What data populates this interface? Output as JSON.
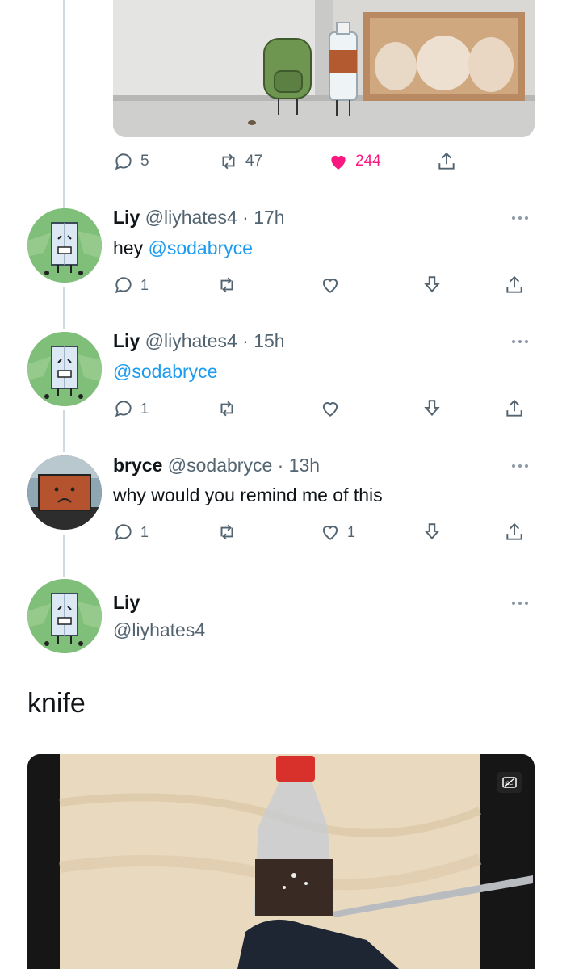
{
  "main_tweet": {
    "actions": {
      "reply_count": "5",
      "retweet_count": "47",
      "like_count": "244"
    }
  },
  "replies": [
    {
      "name": "Liy",
      "handle": "@liyhates4",
      "time": "· 17h",
      "text_prefix": "hey ",
      "mention": "@sodabryce",
      "reply_count": "1",
      "like_count": ""
    },
    {
      "name": "Liy",
      "handle": "@liyhates4",
      "time": "· 15h",
      "text_prefix": "",
      "mention": "@sodabryce",
      "reply_count": "1",
      "like_count": ""
    },
    {
      "name": "bryce",
      "handle": "@sodabryce",
      "time": "· 13h",
      "text_prefix": "why would you remind me of this",
      "mention": "",
      "reply_count": "1",
      "like_count": "1"
    }
  ],
  "focused_tweet": {
    "name": "Liy",
    "handle": "@liyhates4",
    "text": "knife"
  },
  "icons": {
    "reply": "reply-icon",
    "retweet": "retweet-icon",
    "like": "heart-icon",
    "bookmark": "bookmark-icon",
    "share": "share-icon",
    "more": "more-icon",
    "captions": "captions-icon"
  },
  "colors": {
    "like_active": "#f91880",
    "link": "#1d9bf0",
    "secondary_text": "#536471",
    "thread_line": "#cfd9de"
  }
}
